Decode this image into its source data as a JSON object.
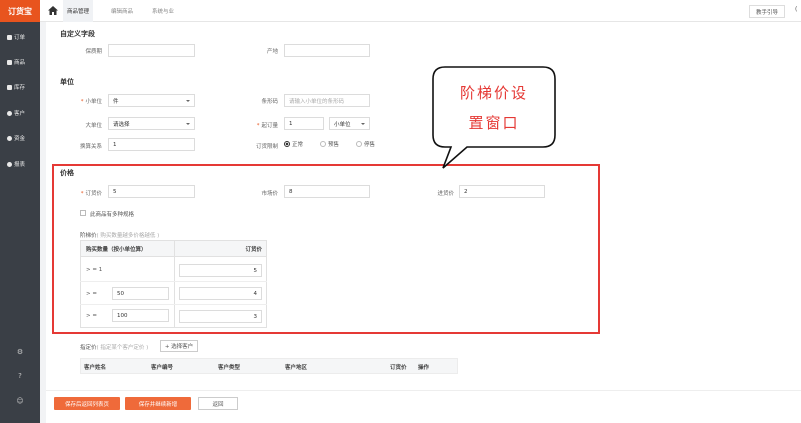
{
  "sidebar": {
    "logo": "订货宝",
    "items": [
      {
        "label": "订单",
        "icon": "document-icon"
      },
      {
        "label": "商品",
        "icon": "box-icon"
      },
      {
        "label": "库存",
        "icon": "warehouse-icon"
      },
      {
        "label": "客户",
        "icon": "user-icon"
      },
      {
        "label": "资金",
        "icon": "money-icon"
      },
      {
        "label": "报表",
        "icon": "chart-icon"
      }
    ],
    "bottom": [
      {
        "glyph": "⚙",
        "icon": "settings-icon"
      },
      {
        "glyph": "?",
        "icon": "help-icon"
      },
      {
        "glyph": "☺",
        "icon": "chat-icon"
      }
    ]
  },
  "header": {
    "tabs": [
      "商品管理",
      "编辑商品",
      "系统与业"
    ],
    "guide_label": "教手引导",
    "right_char": "("
  },
  "custom_fields": {
    "title": "自定义字段",
    "shelf_life_label": "保质期",
    "origin_label": "产地"
  },
  "unit": {
    "title": "单位",
    "min_unit_label": "小单位",
    "min_unit_value": "件",
    "barcode_label": "条形码",
    "barcode_placeholder": "请输入小单位的条形码",
    "big_unit_label": "大单位",
    "big_unit_value": "请选择",
    "min_order_label": "起订量",
    "min_order_value": "1",
    "min_order_unit": "小单位",
    "conversion_label": "换算关系",
    "conversion_value": "1",
    "order_limit_label": "订货限制",
    "order_limit_options": [
      "正常",
      "预售",
      "停售"
    ]
  },
  "price": {
    "title": "价格",
    "order_price_label": "订货价",
    "order_price_value": "5",
    "market_price_label": "市场价",
    "market_price_value": "8",
    "purchase_price_label": "进货价",
    "purchase_price_value": "2",
    "multi_spec_label": "此商品有多种规格",
    "tier_label": "阶梯价",
    "tier_hint": "( 购买数量越多价格越低 )",
    "tier_table": {
      "col_qty": "购买数量（按小单位算）",
      "col_price": "订货价",
      "rows": [
        {
          "op": "> = 1",
          "qty": "",
          "price": "5"
        },
        {
          "op": "> =",
          "qty": "50",
          "price": "4"
        },
        {
          "op": "> =",
          "qty": "100",
          "price": "3"
        }
      ]
    },
    "customer_price_label": "指定价",
    "customer_price_hint": "( 指定某个客户定价 )",
    "select_customer_button": "+ 选择客户",
    "customer_table_cols": [
      "客户姓名",
      "客户编号",
      "客户类型",
      "客户地区",
      "订货价",
      "操作"
    ]
  },
  "annotation": {
    "line1": "阶梯价设",
    "line2": "置窗口",
    "color": "#e53935"
  },
  "footer": {
    "save_return": "保存后返回列表页",
    "save_continue": "保存并继续新增",
    "back": "返回"
  }
}
